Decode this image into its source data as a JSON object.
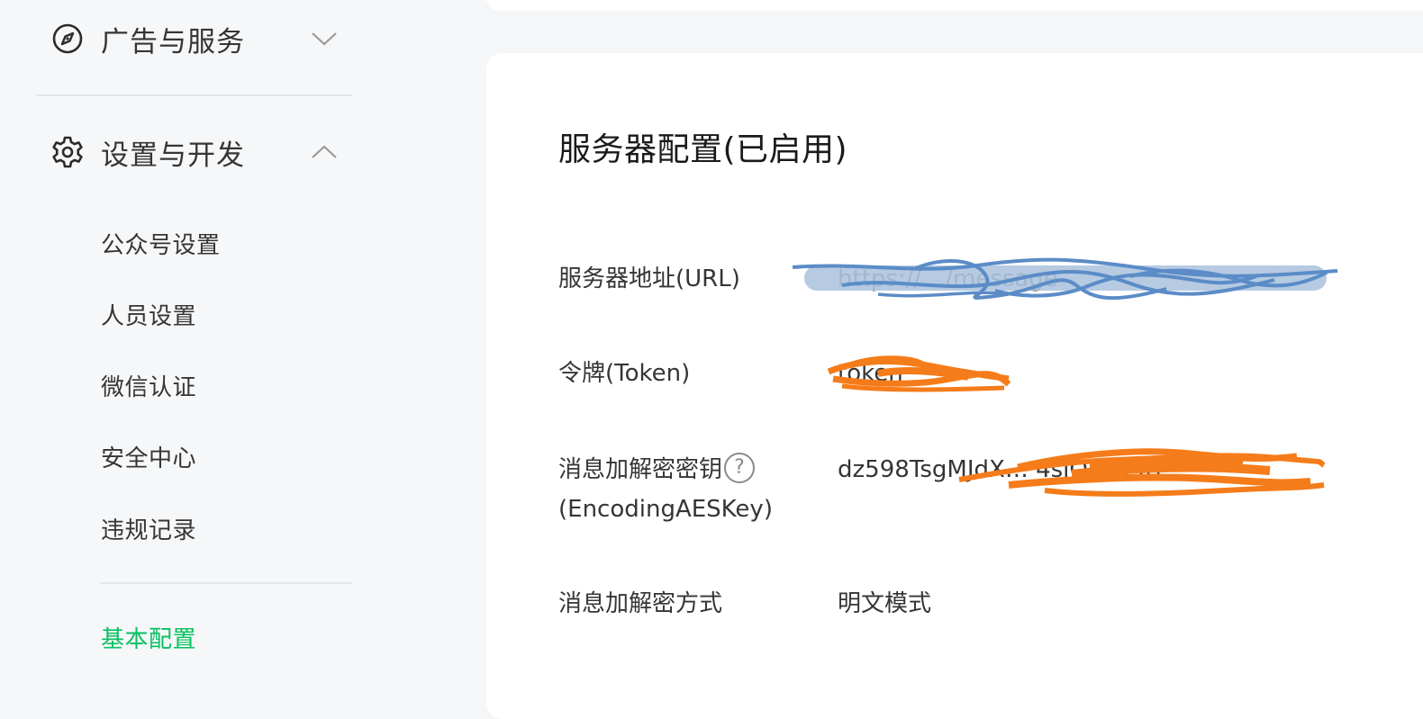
{
  "sidebar": {
    "sections": [
      {
        "label": "广告与服务",
        "icon": "compass-icon",
        "expanded": false
      },
      {
        "label": "设置与开发",
        "icon": "gear-icon",
        "expanded": true
      }
    ],
    "items": [
      {
        "label": "公众号设置"
      },
      {
        "label": "人员设置"
      },
      {
        "label": "微信认证"
      },
      {
        "label": "安全中心"
      },
      {
        "label": "违规记录"
      }
    ],
    "active_item": {
      "label": "基本配置"
    }
  },
  "main": {
    "title": "服务器配置(已启用)",
    "fields": [
      {
        "label": "服务器地址(URL)",
        "value": "https://…/message"
      },
      {
        "label": "令牌(Token)",
        "value": "token"
      },
      {
        "label_line1": "消息加解密密钥",
        "label_line2": "(EncodingAESKey)",
        "value": "dz598TsgMJdX… 4siQrhQ9rF"
      },
      {
        "label": "消息加解密方式",
        "value": "明文模式"
      }
    ]
  },
  "colors": {
    "active": "#07c160",
    "redaction_blue": "#5b8cc7",
    "redaction_orange": "#f57c1a"
  }
}
